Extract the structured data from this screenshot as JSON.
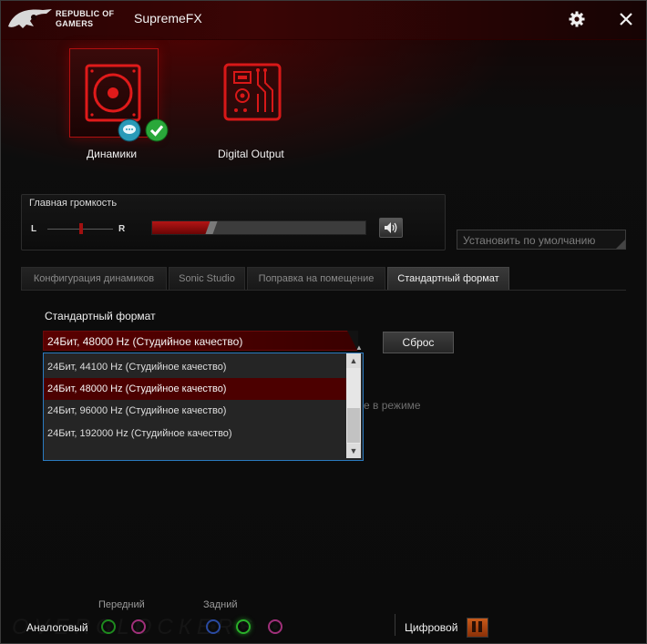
{
  "window": {
    "brand": [
      "REPUBLIC OF",
      "GAMERS"
    ],
    "title": "SupremeFX"
  },
  "devices": [
    {
      "label": "Динамики",
      "selected": true
    },
    {
      "label": "Digital Output",
      "selected": false
    }
  ],
  "volume": {
    "title": "Главная громкость",
    "left_label": "L",
    "right_label": "R",
    "level_percent": 27,
    "balance_percent": 48
  },
  "default_button": "Установить по умолчанию",
  "tabs": [
    {
      "label": "Конфигурация динамиков",
      "active": false
    },
    {
      "label": "Sonic Studio",
      "active": false
    },
    {
      "label": "Поправка на помещение",
      "active": false
    },
    {
      "label": "Стандартный формат",
      "active": true
    }
  ],
  "format": {
    "label": "Стандартный формат",
    "selected_value": "24Бит, 48000 Hz (Студийное качество)",
    "reset_button": "Сброс",
    "options": [
      "24Бит, 44100 Hz (Студийное качество)",
      "24Бит, 48000 Hz (Студийное качество)",
      "24Бит, 96000 Hz (Студийное качество)",
      "24Бит, 192000 Hz (Студийное качество)"
    ],
    "hidden_text": "е в режиме"
  },
  "bottom": {
    "front_label": "Передний",
    "rear_label": "Задний",
    "analog_label": "Аналоговый",
    "digital_label": "Цифровой"
  },
  "colors": {
    "accent": "#b01010",
    "selection": "#4c0000",
    "dropdown_border": "#2a7ac0"
  }
}
